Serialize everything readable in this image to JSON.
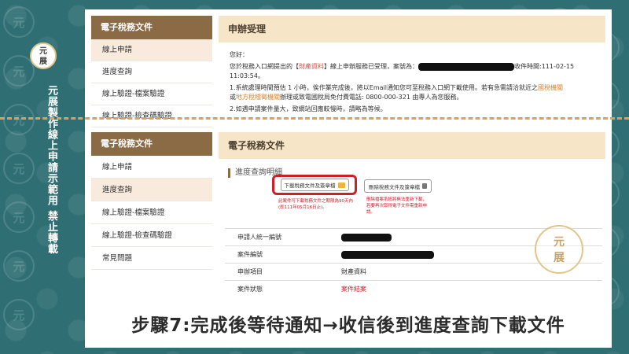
{
  "watermark": {
    "char": "元"
  },
  "logo": {
    "text": "元展"
  },
  "side_caption": "元展製作線上申請示範用 禁止轉載",
  "top_panel": {
    "sidebar": {
      "title": "電子稅務文件",
      "items": [
        "線上申請",
        "進度查詢",
        "線上驗證-檔案驗證",
        "線上驗證-檢查碼驗證"
      ],
      "active_index": 0
    },
    "main": {
      "title": "申辦受理",
      "greeting": "您好：",
      "line1_prefix": "您於稅務入口網提出的【",
      "line1_link": "財產資料",
      "line1_mid": "】線上申辦服務已受理，案號為：",
      "line1_suffix": "收件時間:111-02-15 11:03:54。",
      "line2": "1.系統處理時間預估 1 小時，俟作業完成後，將以Email通知您可至稅務入口網下載使用。若有急需請洽就近之",
      "line2_link1": "國稅機關",
      "line2_or": "或",
      "line2_link2": "地方稅稽徵機關",
      "line2_end": "辦理或致電國稅局免付費電話: 0800-000-321 由專人為您服務。",
      "line3": "2.如遇申請案件量大，致網站回應較慢時，請略為等候。"
    }
  },
  "bottom_panel": {
    "sidebar": {
      "title": "電子稅務文件",
      "items": [
        "線上申請",
        "進度查詢",
        "線上驗證-檔案驗證",
        "線上驗證-檢查碼驗證",
        "常見問題"
      ],
      "active_index": 1
    },
    "main": {
      "title": "電子稅務文件",
      "section_title": "進度查詢明細",
      "download_button": "下載稅務文件及簽章檔",
      "delete_button": "刪除稅務文件及簽章檔",
      "note_left": "此案件可下載稅務文件之期限為90天內 (即111年05月16日止)。",
      "note_right": "刪除檔案系統將無法重新下載，若要再次取得電子文件需重新申請。",
      "table": [
        {
          "label": "申請人統一編號",
          "value": ""
        },
        {
          "label": "案件編號",
          "value": ""
        },
        {
          "label": "申辦項目",
          "value": "財產資料"
        },
        {
          "label": "案件狀態",
          "value": "案件結案"
        }
      ]
    }
  },
  "caption": "步驟7:完成後等待通知→收信後到進度查詢下載文件",
  "stamp": {
    "text": "元展"
  },
  "colors": {
    "background": "#2f6f73",
    "sidebar_header": "#8a6b46",
    "main_header": "#f7e5c8",
    "dashed": "#e0a050",
    "highlight_red": "#c8212c"
  }
}
